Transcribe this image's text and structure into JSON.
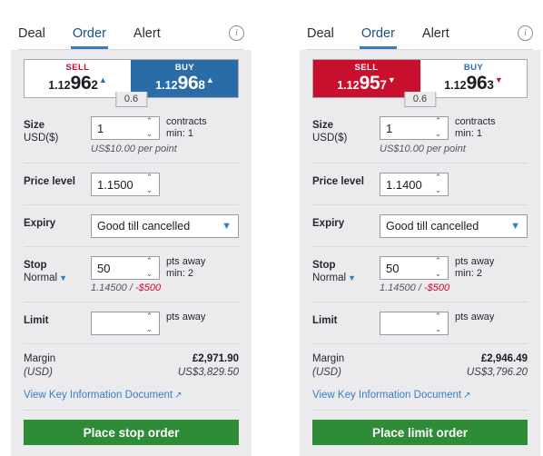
{
  "tickets": [
    {
      "id": "stop-order-ticket",
      "tabs": [
        {
          "label": "Deal",
          "active": false
        },
        {
          "label": "Order",
          "active": true
        },
        {
          "label": "Alert",
          "active": false
        }
      ],
      "info_icon": "i",
      "ticker": {
        "spread": "0.6",
        "sell": {
          "label": "SELL",
          "state": "inactive",
          "price_small": "1.12",
          "price_big": "96",
          "price_tail": "2",
          "arrow": "▲",
          "arrow_dir": "up",
          "arrow_color": "#2a6ca8"
        },
        "buy": {
          "label": "BUY",
          "state": "active",
          "price_small": "1.12",
          "price_big": "96",
          "price_tail": "8",
          "arrow": "▲",
          "arrow_dir": "up",
          "arrow_color": "#ffffff"
        }
      },
      "size": {
        "label": "Size",
        "sub": "USD($)",
        "value": "1",
        "units": "contracts",
        "min": "min: 1",
        "hint": "US$10.00 per point"
      },
      "price_level": {
        "label": "Price level",
        "value": "1.1500"
      },
      "expiry": {
        "label": "Expiry",
        "value": "Good till cancelled"
      },
      "stop": {
        "label": "Stop",
        "sub": "Normal",
        "value": "50",
        "units": "pts away",
        "min": "min: 2",
        "hint_level": "1.14500 / ",
        "hint_amount": "-$500"
      },
      "limit": {
        "label": "Limit",
        "value": "",
        "units": "pts away"
      },
      "margin": {
        "label": "Margin",
        "currency": "(USD)",
        "value": "£2,971.90",
        "value_converted": "US$3,829.50"
      },
      "kid_link": {
        "label": "View Key Information Document",
        "icon": "↗"
      },
      "place_button": "Place stop order"
    },
    {
      "id": "limit-order-ticket",
      "tabs": [
        {
          "label": "Deal",
          "active": false
        },
        {
          "label": "Order",
          "active": true
        },
        {
          "label": "Alert",
          "active": false
        }
      ],
      "info_icon": "i",
      "ticker": {
        "spread": "0.6",
        "sell": {
          "label": "SELL",
          "state": "active",
          "price_small": "1.12",
          "price_big": "95",
          "price_tail": "7",
          "arrow": "▼",
          "arrow_dir": "down",
          "arrow_color": "#ffffff"
        },
        "buy": {
          "label": "BUY",
          "state": "inactive",
          "price_small": "1.12",
          "price_big": "96",
          "price_tail": "3",
          "arrow": "▼",
          "arrow_dir": "down",
          "arrow_color": "#c8102e"
        }
      },
      "size": {
        "label": "Size",
        "sub": "USD($)",
        "value": "1",
        "units": "contracts",
        "min": "min: 1",
        "hint": "US$10.00 per point"
      },
      "price_level": {
        "label": "Price level",
        "value": "1.1400"
      },
      "expiry": {
        "label": "Expiry",
        "value": "Good till cancelled"
      },
      "stop": {
        "label": "Stop",
        "sub": "Normal",
        "value": "50",
        "units": "pts away",
        "min": "min: 2",
        "hint_level": "1.14500 / ",
        "hint_amount": "-$500"
      },
      "limit": {
        "label": "Limit",
        "value": "",
        "units": "pts away"
      },
      "margin": {
        "label": "Margin",
        "currency": "(USD)",
        "value": "£2,946.49",
        "value_converted": "US$3,796.20"
      },
      "kid_link": {
        "label": "View Key Information Document",
        "icon": "↗"
      },
      "place_button": "Place limit order"
    }
  ],
  "colors": {
    "sell_red": "#c8102e",
    "buy_blue": "#2a6ca8",
    "accent_blue": "#3a7cc4",
    "place_green": "#2e8b36",
    "panel_bg": "#ebebed"
  },
  "spinner": {
    "up": "⌃",
    "down": "⌄"
  }
}
